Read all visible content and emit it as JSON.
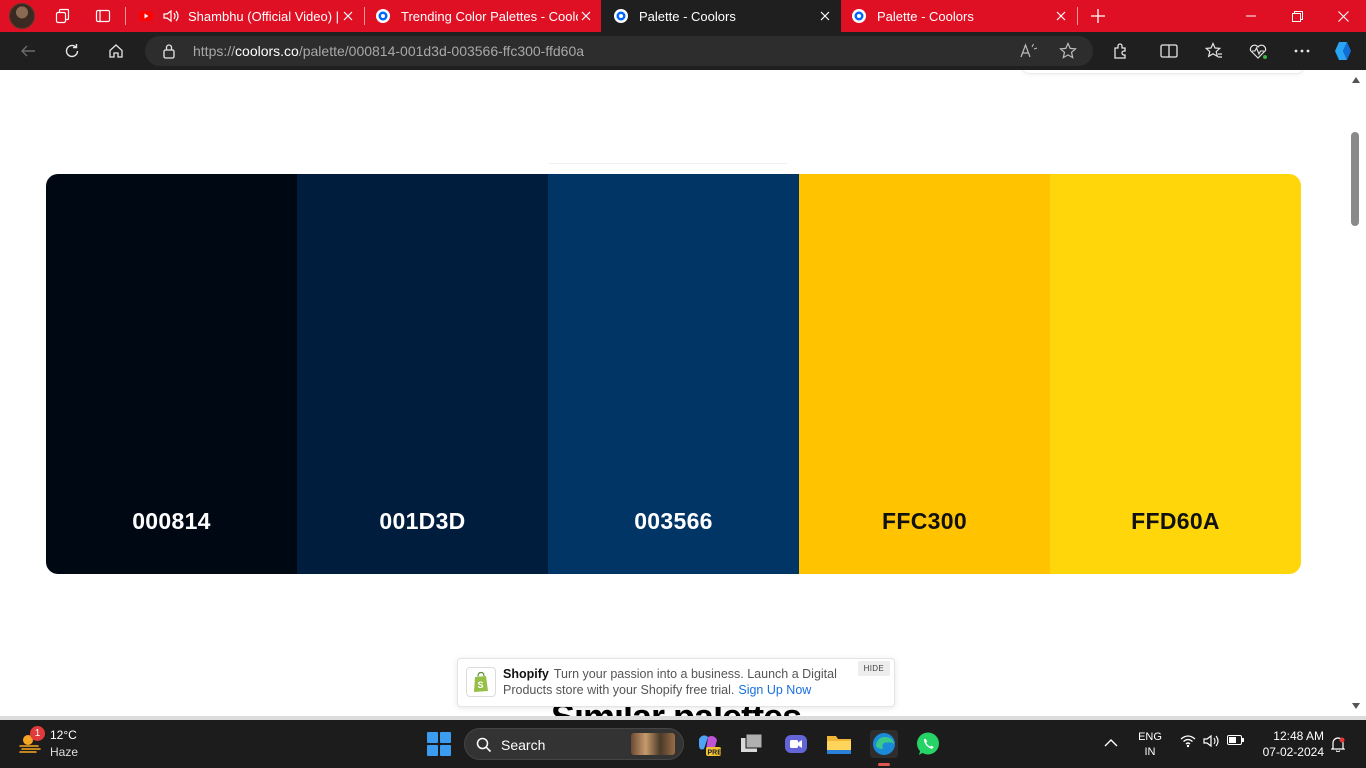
{
  "browser": {
    "tabs": [
      {
        "title": "Shambhu (Official Video) | A",
        "state": "background"
      },
      {
        "title": "Trending Color Palettes - Coolors",
        "state": "background"
      },
      {
        "title": "Palette - Coolors",
        "state": "selected"
      },
      {
        "title": "Palette - Coolors",
        "state": "background"
      }
    ],
    "url": {
      "scheme": "https://",
      "host": "coolors.co",
      "path": "/palette/000814-001d3d-003566-ffc300-ffd60a"
    }
  },
  "page": {
    "palette": [
      {
        "hex": "000814",
        "color": "#000814",
        "text_color": "#ffffff"
      },
      {
        "hex": "001D3D",
        "color": "#001d3d",
        "text_color": "#ffffff"
      },
      {
        "hex": "003566",
        "color": "#003566",
        "text_color": "#ffffff"
      },
      {
        "hex": "FFC300",
        "color": "#ffc300",
        "text_color": "#111111"
      },
      {
        "hex": "FFD60A",
        "color": "#ffd60a",
        "text_color": "#111111"
      }
    ],
    "section_heading": "Similar palettes",
    "ad": {
      "brand": "Shopify",
      "text": "Turn your passion into a business. Launch a Digital Products store with your Shopify free trial.",
      "cta": "Sign Up Now",
      "hide_label": "HIDE"
    }
  },
  "taskbar": {
    "weather": {
      "temp": "12°C",
      "condition": "Haze",
      "badge": "1"
    },
    "search_label": "Search",
    "tray": {
      "lang1": "ENG",
      "lang2": "IN"
    },
    "clock": {
      "time": "12:48 AM",
      "date": "07-02-2024"
    }
  },
  "colors": {
    "tab_bar": "#e01024",
    "selected_tab": "#1f1f1f",
    "toolbar": "#1f1f1f",
    "taskbar": "#1c1c1c"
  }
}
